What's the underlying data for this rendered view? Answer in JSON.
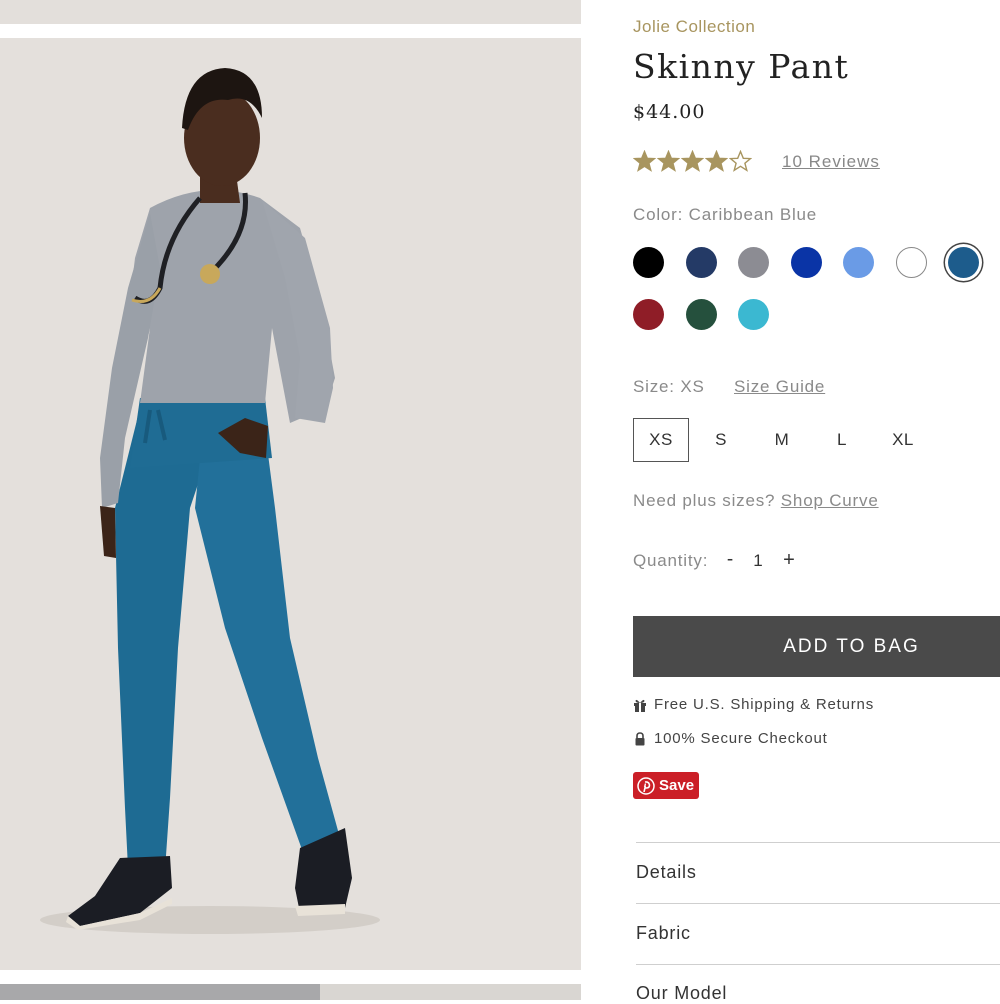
{
  "product": {
    "collection": "Jolie Collection",
    "title": "Skinny Pant",
    "price": "$44.00",
    "rating": 4,
    "rating_max": 5,
    "reviews_label": "10 Reviews"
  },
  "color": {
    "label": "Color: Caribbean Blue",
    "swatches": [
      {
        "name": "black",
        "hex": "#000000"
      },
      {
        "name": "navy",
        "hex": "#243a66"
      },
      {
        "name": "grey",
        "hex": "#8c8c93"
      },
      {
        "name": "royal-blue",
        "hex": "#0a34a6"
      },
      {
        "name": "light-blue",
        "hex": "#6a9be6"
      },
      {
        "name": "white",
        "hex": "#ffffff"
      },
      {
        "name": "caribbean-blue",
        "hex": "#1d5c8c",
        "selected": true
      },
      {
        "name": "red",
        "hex": "#8f1d27"
      },
      {
        "name": "green",
        "hex": "#25503d"
      },
      {
        "name": "turquoise",
        "hex": "#3bb8d1"
      }
    ]
  },
  "size": {
    "label": "Size: XS",
    "guide_label": "Size Guide",
    "options": [
      "XS",
      "S",
      "M",
      "L",
      "XL"
    ],
    "selected": "XS"
  },
  "plus": {
    "text": "Need plus sizes?",
    "link": "Shop Curve"
  },
  "quantity": {
    "label": "Quantity:",
    "minus": "-",
    "value": "1",
    "plus": "+"
  },
  "cta": {
    "add_to_bag": "ADD TO BAG"
  },
  "perks": {
    "shipping": "Free U.S. Shipping & Returns",
    "secure": "100% Secure Checkout"
  },
  "pinterest": {
    "label": "Save"
  },
  "accordion": [
    "Details",
    "Fabric",
    "Our Model"
  ],
  "colors": {
    "accent_gold": "#a8955f",
    "button_bg": "#4a4a4a",
    "pinterest_red": "#cb1f27"
  }
}
